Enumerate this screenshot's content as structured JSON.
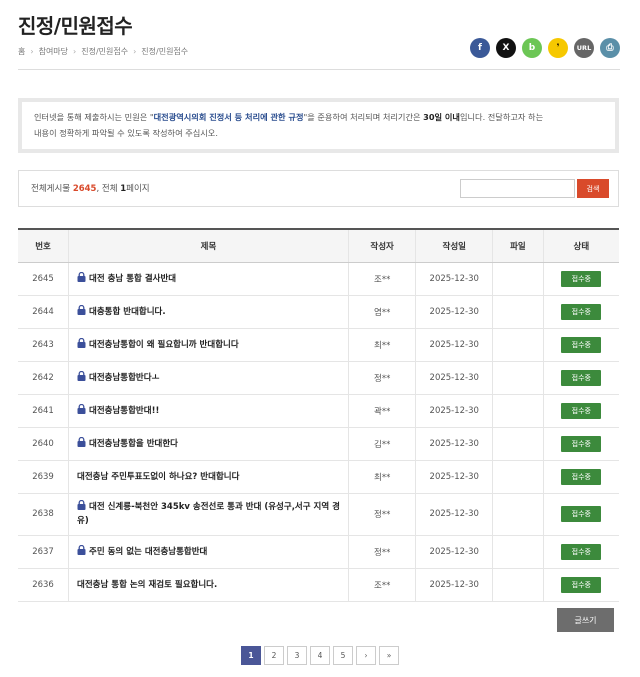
{
  "page": {
    "title": "진정/민원접수"
  },
  "breadcrumb": {
    "home": "홈",
    "items": [
      "참여마당",
      "진정/민원접수",
      "진정/민원접수"
    ]
  },
  "share": {
    "facebook": "f",
    "x": "X",
    "band": "b",
    "story": "❜",
    "url": "URL",
    "print": "⎙"
  },
  "notice": {
    "part1": "인터넷을 통해 제출하시는 민원은 \"",
    "bold1": "대전광역시의회 진정서 등 처리에 관한 규정",
    "part2": "\"을 준용하여 처리되며 처리기간은 ",
    "bold2": "30일 이내",
    "part3": "입니다. 전달하고자 하는",
    "line2": "내용이 정확하게 파악될 수 있도록 작성하여 주십시오."
  },
  "search": {
    "prefix": "전체게시물 ",
    "total": "2645",
    "mid": ", 전체 ",
    "pages": "1",
    "suffix": "페이지",
    "placeholder": "",
    "button": "검색"
  },
  "table": {
    "headers": {
      "num": "번호",
      "subject": "제목",
      "author": "작성자",
      "date": "작성일",
      "file": "파일",
      "status": "상태"
    },
    "rows": [
      {
        "num": "2645",
        "locked": true,
        "subject": "대전 충남 통합 결사반대",
        "author": "조**",
        "date": "2025-12-30",
        "status": "접수중"
      },
      {
        "num": "2644",
        "locked": true,
        "subject": "대충통합 반대합니다.",
        "author": "염**",
        "date": "2025-12-30",
        "status": "접수중"
      },
      {
        "num": "2643",
        "locked": true,
        "subject": "대전충남통합이 왜 필요합니까 반대합니다",
        "author": "최**",
        "date": "2025-12-30",
        "status": "접수중"
      },
      {
        "num": "2642",
        "locked": true,
        "subject": "대전충남통합반다ㅗ",
        "author": "정**",
        "date": "2025-12-30",
        "status": "접수중"
      },
      {
        "num": "2641",
        "locked": true,
        "subject": "대전충남통합반대!!",
        "author": "곽**",
        "date": "2025-12-30",
        "status": "접수중"
      },
      {
        "num": "2640",
        "locked": true,
        "subject": "대전충남통합을 반대한다",
        "author": "김**",
        "date": "2025-12-30",
        "status": "접수중"
      },
      {
        "num": "2639",
        "locked": false,
        "subject": "대전충남 주민투표도없이 하나요? 반대합니다",
        "author": "최**",
        "date": "2025-12-30",
        "status": "접수중"
      },
      {
        "num": "2638",
        "locked": true,
        "subject": "대전 신계룡-북천안 345kv 송전선로 통과 반대 (유성구,서구 지역 경유)",
        "author": "정**",
        "date": "2025-12-30",
        "status": "접수중"
      },
      {
        "num": "2637",
        "locked": true,
        "subject": "주민 동의 없는 대전충남통합반대",
        "author": "정**",
        "date": "2025-12-30",
        "status": "접수중"
      },
      {
        "num": "2636",
        "locked": false,
        "subject": "대전충남 통합 논의 재검토 필요합니다.",
        "author": "조**",
        "date": "2025-12-30",
        "status": "접수중"
      }
    ]
  },
  "write_button": "글쓰기",
  "pagination": {
    "pages": [
      "1",
      "2",
      "3",
      "4",
      "5"
    ],
    "current": "1",
    "next": "›",
    "last": "»"
  }
}
